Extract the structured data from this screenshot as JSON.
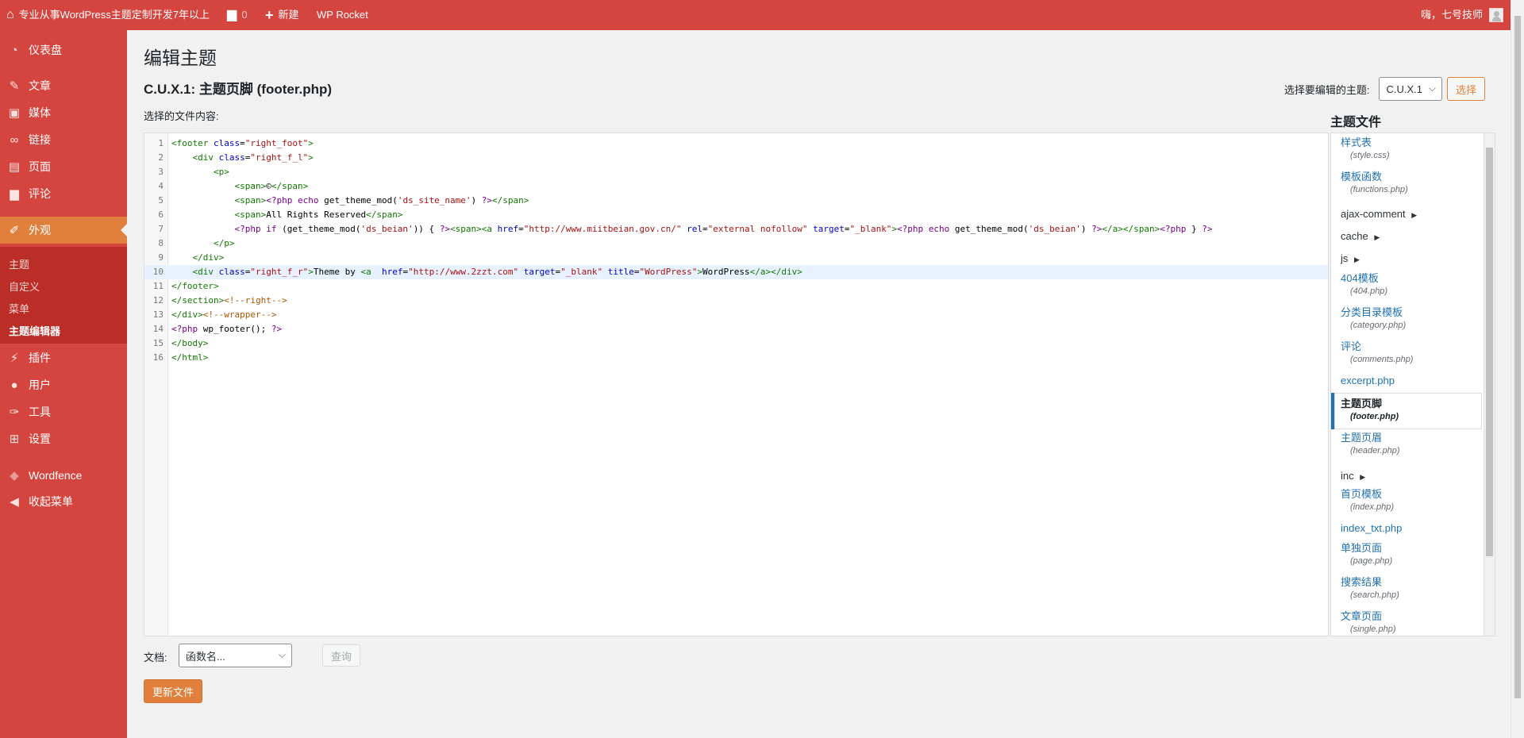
{
  "adminbar": {
    "site_name": "专业从事WordPress主题定制开发7年以上",
    "comments_count": "0",
    "new_label": "新建",
    "wp_rocket": "WP Rocket",
    "greeting": "嗨，七号技师"
  },
  "sidebar": {
    "items": [
      {
        "label": "仪表盘",
        "icon": "dashboard-icon"
      },
      {
        "label": "文章",
        "icon": "pin-icon"
      },
      {
        "label": "媒体",
        "icon": "media-icon"
      },
      {
        "label": "链接",
        "icon": "link-icon"
      },
      {
        "label": "页面",
        "icon": "page-icon"
      },
      {
        "label": "评论",
        "icon": "comment-icon"
      },
      {
        "label": "外观",
        "icon": "brush-icon"
      },
      {
        "label": "插件",
        "icon": "plugin-icon"
      },
      {
        "label": "用户",
        "icon": "user-icon"
      },
      {
        "label": "工具",
        "icon": "wrench-icon"
      },
      {
        "label": "设置",
        "icon": "settings-icon"
      },
      {
        "label": "Wordfence",
        "icon": "wordfence-icon"
      },
      {
        "label": "收起菜单",
        "icon": "collapse-icon"
      }
    ],
    "submenu": [
      "主题",
      "自定义",
      "菜单",
      "主题编辑器"
    ]
  },
  "header": {
    "page_title": "编辑主题",
    "theme_prefix": "C.U.X.1: ",
    "file_title_bold": "主题页脚",
    "file_title_rest": " (footer.php)",
    "select_label": "选择要编辑的主题:",
    "selected_theme": "C.U.X.1",
    "select_button": "选择",
    "content_label": "选择的文件内容:"
  },
  "editor": {
    "line_numbers": [
      "1",
      "2",
      "3",
      "4",
      "5",
      "6",
      "7",
      "8",
      "9",
      "10",
      "11",
      "12",
      "13",
      "14",
      "15",
      "16"
    ]
  },
  "files": {
    "heading": "主题文件",
    "items": [
      {
        "name": "样式表",
        "sub": "(style.css)"
      },
      {
        "name": "模板函数",
        "sub": "(functions.php)"
      },
      {
        "name": "ajax-comment",
        "dir": true
      },
      {
        "name": "cache",
        "dir": true
      },
      {
        "name": "js",
        "dir": true
      },
      {
        "name": "404模板",
        "sub": "(404.php)"
      },
      {
        "name": "分类目录模板",
        "sub": "(category.php)"
      },
      {
        "name": "评论",
        "sub": "(comments.php)"
      },
      {
        "name": "excerpt.php"
      },
      {
        "name": "主题页脚",
        "sub": "(footer.php)",
        "current": true
      },
      {
        "name": "主题页眉",
        "sub": "(header.php)"
      },
      {
        "name": "inc",
        "dir": true
      },
      {
        "name": "首页模板",
        "sub": "(index.php)"
      },
      {
        "name": "index_txt.php"
      },
      {
        "name": "单独页面",
        "sub": "(page.php)"
      },
      {
        "name": "搜索结果",
        "sub": "(search.php)"
      },
      {
        "name": "文章页面",
        "sub": "(single.php)"
      }
    ]
  },
  "bottom": {
    "doc_label": "文档:",
    "doc_placeholder": "函数名...",
    "lookup_button": "查询",
    "update_button": "更新文件"
  },
  "colors": {
    "admin_red": "#d4453f",
    "accent_orange": "#e1803d",
    "submenu_dark": "#bb2e28",
    "link_blue": "#2271b1"
  }
}
